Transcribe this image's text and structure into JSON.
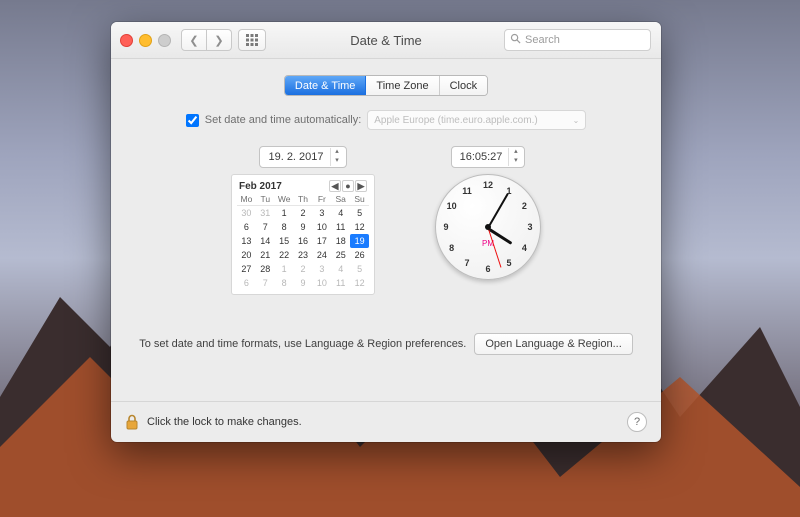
{
  "window": {
    "title": "Date & Time"
  },
  "search": {
    "placeholder": "Search"
  },
  "tabs": {
    "date_time": "Date & Time",
    "time_zone": "Time Zone",
    "clock": "Clock",
    "active": 0
  },
  "auto": {
    "label": "Set date and time automatically:",
    "checked": true,
    "server": "Apple Europe (time.euro.apple.com.)"
  },
  "date_field": "19. 2. 2017",
  "time_field": "16:05:27",
  "calendar": {
    "month_label": "Feb 2017",
    "dow": [
      "Mo",
      "Tu",
      "We",
      "Th",
      "Fr",
      "Sa",
      "Su"
    ],
    "leading": [
      30,
      31
    ],
    "days": [
      1,
      2,
      3,
      4,
      5,
      6,
      7,
      8,
      9,
      10,
      11,
      12,
      13,
      14,
      15,
      16,
      17,
      18,
      19,
      20,
      21,
      22,
      23,
      24,
      25,
      26,
      27,
      28
    ],
    "trailing": [
      1,
      2,
      3,
      4,
      5,
      6,
      7,
      8,
      9,
      10,
      11,
      12
    ],
    "selected": 19
  },
  "clock": {
    "hour": 4,
    "minute": 5,
    "second": 27,
    "ampm": "PM",
    "numerals": [
      "12",
      "1",
      "2",
      "3",
      "4",
      "5",
      "6",
      "7",
      "8",
      "9",
      "10",
      "11"
    ]
  },
  "hint": "To set date and time formats, use Language & Region preferences.",
  "open_lang_btn": "Open Language & Region...",
  "footer": {
    "lock_text": "Click the lock to make changes.",
    "help": "?"
  }
}
